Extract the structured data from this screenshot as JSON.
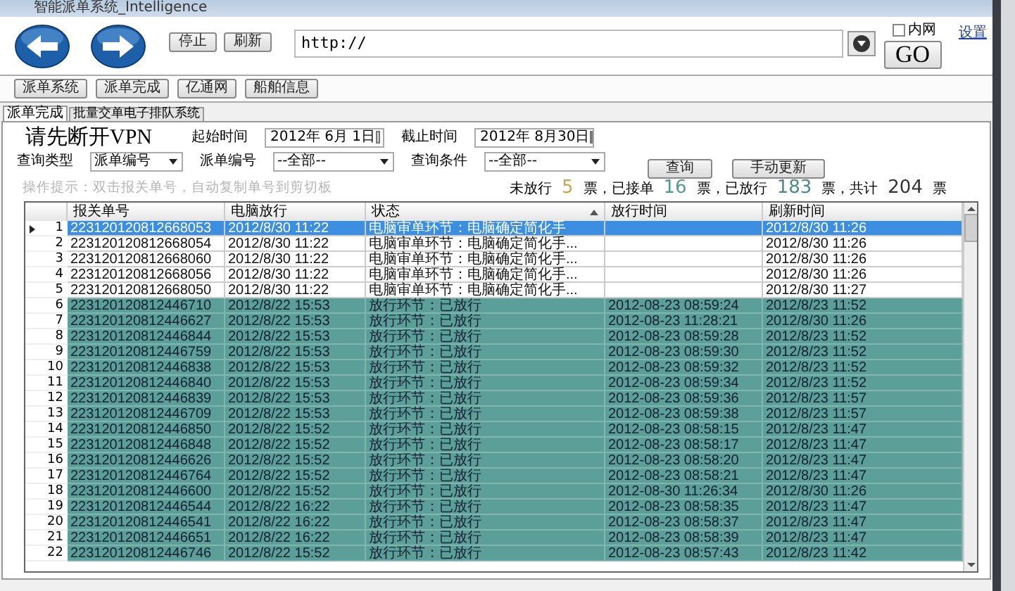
{
  "window": {
    "title": "智能派单系统_Intelligence"
  },
  "toolbar": {
    "buttons": [
      "停止",
      "刷新"
    ],
    "url": "http://",
    "intranet": {
      "label": "内网",
      "checked": false
    },
    "go": "GO",
    "settings": "设置"
  },
  "nav_buttons": [
    "派单系统",
    "派单完成",
    "亿通网",
    "船舶信息"
  ],
  "tabs": [
    {
      "label": "派单完成",
      "selected": true
    },
    {
      "label": "批量交单电子排队系统",
      "selected": false
    }
  ],
  "form": {
    "notice": "请先断开VPN",
    "start_label": "起始时间",
    "start_date": "2012年 6月 1日",
    "end_label": "截止时间",
    "end_date": "2012年 8月30日",
    "query_type_label": "查询类型",
    "query_type_value": "派单编号",
    "field_label": "派单编号",
    "field_value": "--全部--",
    "condition_label": "查询条件",
    "condition_value": "--全部--",
    "buttons": [
      "查询",
      "手动更新"
    ]
  },
  "hint": "操作提示：双击报关单号，自动复制单号到剪切板",
  "stats": [
    {
      "label": "未放行",
      "value": "5",
      "color": "#c9a64a"
    },
    {
      "label": "票，已接单",
      "value": "16",
      "color": "#4f9a8c"
    },
    {
      "label": "票，已放行",
      "value": "183",
      "color": "#4f8a8a"
    },
    {
      "label": "票，共计",
      "value": "204",
      "color": "#333333"
    }
  ],
  "stats_unit": "票",
  "table": {
    "columns": [
      "报关单号",
      "电脑放行",
      "状态",
      "放行时间",
      "刷新时间"
    ],
    "rows": [
      {
        "number": "1",
        "selected": true,
        "kind": "pending",
        "cells": [
          "223120120812668053",
          "2012/8/30 11:22",
          "电脑审单环节：电脑确定简化手",
          "",
          "2012/8/30 11:26"
        ]
      },
      {
        "number": "2",
        "selected": false,
        "kind": "pending",
        "cells": [
          "223120120812668054",
          "2012/8/30 11:22",
          "电脑审单环节：电脑确定简化手...",
          "",
          "2012/8/30 11:26"
        ]
      },
      {
        "number": "3",
        "selected": false,
        "kind": "pending",
        "cells": [
          "223120120812668060",
          "2012/8/30 11:22",
          "电脑审单环节：电脑确定简化手...",
          "",
          "2012/8/30 11:26"
        ]
      },
      {
        "number": "4",
        "selected": false,
        "kind": "pending",
        "cells": [
          "223120120812668056",
          "2012/8/30 11:22",
          "电脑审单环节：电脑确定简化手...",
          "",
          "2012/8/30 11:26"
        ]
      },
      {
        "number": "5",
        "selected": false,
        "kind": "pending",
        "cells": [
          "223120120812668050",
          "2012/8/30 11:22",
          "电脑审单环节：电脑确定简化手...",
          "",
          "2012/8/30 11:27"
        ]
      },
      {
        "number": "6",
        "selected": false,
        "kind": "released",
        "cells": [
          "223120120812446710",
          "2012/8/22 15:53",
          "放行环节：已放行",
          "2012-08-23 08:59:24",
          "2012/8/23 11:52"
        ]
      },
      {
        "number": "7",
        "selected": false,
        "kind": "released",
        "cells": [
          "223120120812446627",
          "2012/8/22 15:53",
          "放行环节：已放行",
          "2012-08-23 11:28:21",
          "2012/8/30 11:26"
        ]
      },
      {
        "number": "8",
        "selected": false,
        "kind": "released",
        "cells": [
          "223120120812446844",
          "2012/8/22 15:53",
          "放行环节：已放行",
          "2012-08-23 08:59:28",
          "2012/8/23 11:52"
        ]
      },
      {
        "number": "9",
        "selected": false,
        "kind": "released",
        "cells": [
          "223120120812446759",
          "2012/8/22 15:53",
          "放行环节：已放行",
          "2012-08-23 08:59:30",
          "2012/8/23 11:52"
        ]
      },
      {
        "number": "10",
        "selected": false,
        "kind": "released",
        "cells": [
          "223120120812446838",
          "2012/8/22 15:53",
          "放行环节：已放行",
          "2012-08-23 08:59:32",
          "2012/8/23 11:52"
        ]
      },
      {
        "number": "11",
        "selected": false,
        "kind": "released",
        "cells": [
          "223120120812446840",
          "2012/8/22 15:53",
          "放行环节：已放行",
          "2012-08-23 08:59:34",
          "2012/8/23 11:52"
        ]
      },
      {
        "number": "12",
        "selected": false,
        "kind": "released",
        "cells": [
          "223120120812446839",
          "2012/8/22 15:53",
          "放行环节：已放行",
          "2012-08-23 08:59:36",
          "2012/8/23 11:57"
        ]
      },
      {
        "number": "13",
        "selected": false,
        "kind": "released",
        "cells": [
          "223120120812446709",
          "2012/8/22 15:53",
          "放行环节：已放行",
          "2012-08-23 08:59:38",
          "2012/8/23 11:57"
        ]
      },
      {
        "number": "14",
        "selected": false,
        "kind": "released",
        "cells": [
          "223120120812446850",
          "2012/8/22 15:52",
          "放行环节：已放行",
          "2012-08-23 08:58:15",
          "2012/8/23 11:47"
        ]
      },
      {
        "number": "15",
        "selected": false,
        "kind": "released",
        "cells": [
          "223120120812446848",
          "2012/8/22 15:52",
          "放行环节：已放行",
          "2012-08-23 08:58:17",
          "2012/8/23 11:47"
        ]
      },
      {
        "number": "16",
        "selected": false,
        "kind": "released",
        "cells": [
          "223120120812446626",
          "2012/8/22 15:52",
          "放行环节：已放行",
          "2012-08-23 08:58:20",
          "2012/8/23 11:47"
        ]
      },
      {
        "number": "17",
        "selected": false,
        "kind": "released",
        "cells": [
          "223120120812446764",
          "2012/8/22 15:52",
          "放行环节：已放行",
          "2012-08-23 08:58:21",
          "2012/8/23 11:47"
        ]
      },
      {
        "number": "18",
        "selected": false,
        "kind": "released",
        "cells": [
          "223120120812446600",
          "2012/8/22 15:52",
          "放行环节：已放行",
          "2012-08-30 11:26:34",
          "2012/8/30 11:26"
        ]
      },
      {
        "number": "19",
        "selected": false,
        "kind": "released",
        "cells": [
          "223120120812446544",
          "2012/8/22 16:22",
          "放行环节：已放行",
          "2012-08-23 08:58:35",
          "2012/8/23 11:47"
        ]
      },
      {
        "number": "20",
        "selected": false,
        "kind": "released",
        "cells": [
          "223120120812446541",
          "2012/8/22 16:22",
          "放行环节：已放行",
          "2012-08-23 08:58:37",
          "2012/8/23 11:47"
        ]
      },
      {
        "number": "21",
        "selected": false,
        "kind": "released",
        "cells": [
          "223120120812446651",
          "2012/8/22 16:22",
          "放行环节：已放行",
          "2012-08-23 08:58:39",
          "2012/8/23 11:47"
        ]
      },
      {
        "number": "22",
        "selected": false,
        "kind": "released",
        "cells": [
          "223120120812446746",
          "2012/8/22 15:52",
          "放行环节：已放行",
          "2012-08-23 08:57:43",
          "2012/8/23 11:42"
        ]
      }
    ]
  }
}
